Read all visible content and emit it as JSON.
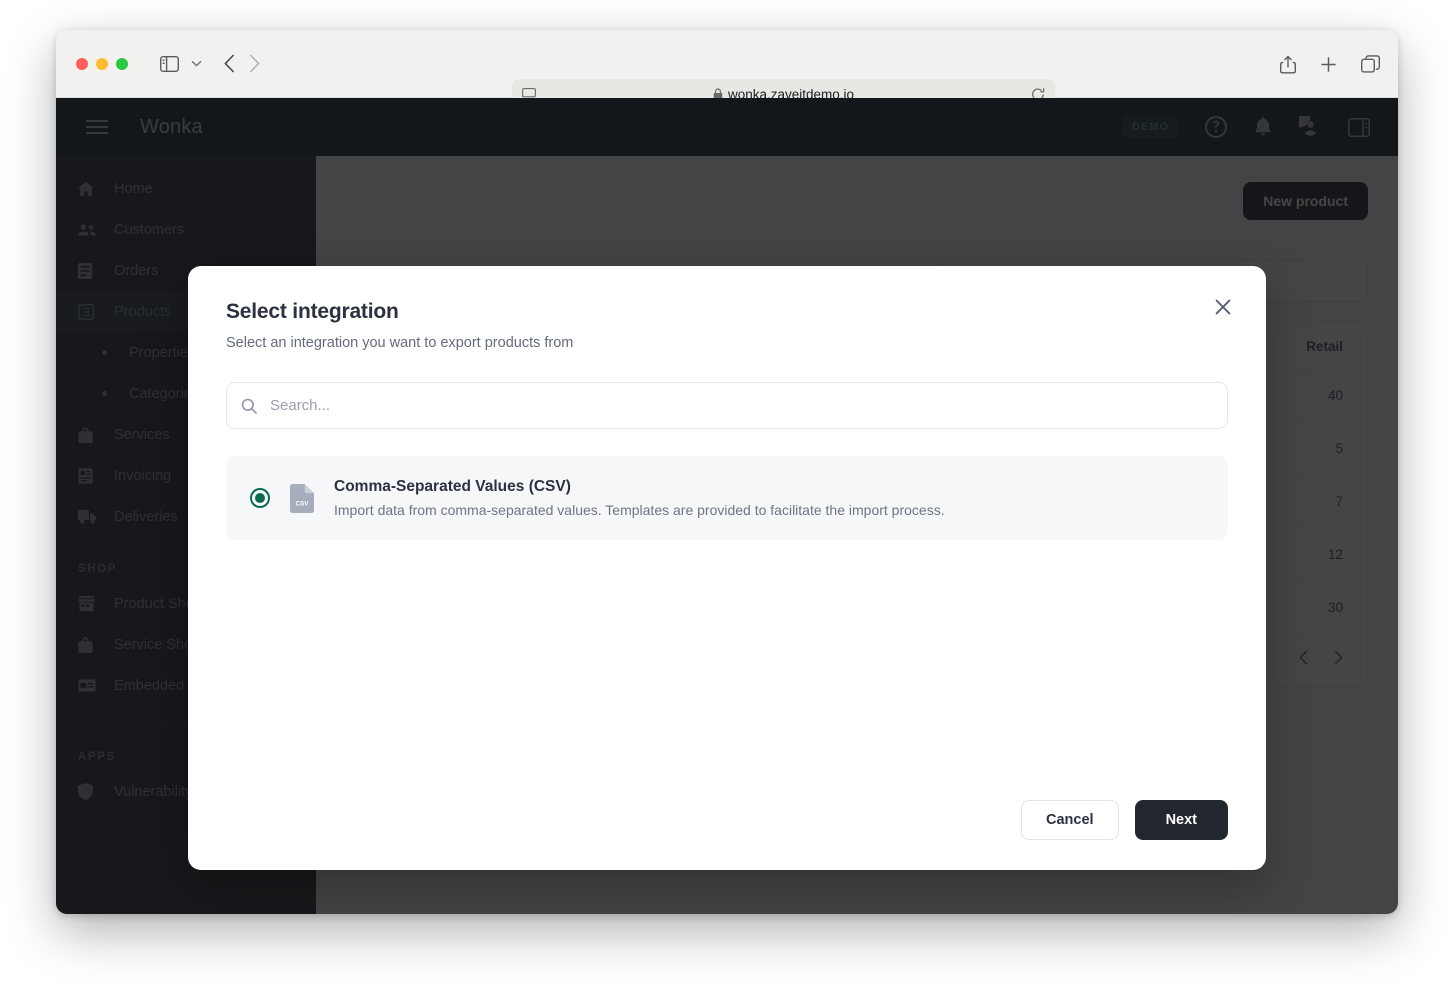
{
  "browser": {
    "url": "wonka.zaveitdemo.io",
    "lock_icon": "lock-icon",
    "reader_icon": "reader-view-icon",
    "reload_icon": "reload-icon",
    "sidebar_icon": "sidebar-toggle-icon",
    "back_icon": "back-arrow-icon",
    "forward_icon": "forward-arrow-icon",
    "share_icon": "share-icon",
    "new_tab_icon": "plus-icon",
    "tabs_icon": "tab-overview-icon"
  },
  "app_header": {
    "brand": "Wonka",
    "badge": "DEMO",
    "menu_icon": "hamburger-icon",
    "help_icon": "help-circle-icon",
    "bell_icon": "bell-icon",
    "account_icon": "account-circle-icon",
    "panel_icon": "right-panel-icon"
  },
  "sidebar": {
    "items": [
      {
        "label": "Home",
        "icon": "home-icon",
        "active": false
      },
      {
        "label": "Customers",
        "icon": "people-icon",
        "active": false
      },
      {
        "label": "Orders",
        "icon": "orders-icon",
        "active": false
      },
      {
        "label": "Products",
        "icon": "products-icon",
        "active": true
      }
    ],
    "sub_items": [
      {
        "label": "Properties"
      },
      {
        "label": "Categories"
      }
    ],
    "items_after": [
      {
        "label": "Services",
        "icon": "bag-icon",
        "active": false
      },
      {
        "label": "Invoicing",
        "icon": "invoice-icon",
        "active": false
      },
      {
        "label": "Deliveries",
        "icon": "truck-icon",
        "active": false
      }
    ],
    "shop_section": "SHOP",
    "shop_items": [
      {
        "label": "Product Shop",
        "icon": "storefront-icon"
      },
      {
        "label": "Service Shop",
        "icon": "bag-icon"
      },
      {
        "label": "Embedded Shop",
        "icon": "embed-icon"
      }
    ],
    "apps_section": "APPS",
    "apps_items": [
      {
        "label": "Vulnerability Scan",
        "icon": "shield-icon",
        "chevron": "chevron-right-icon"
      }
    ]
  },
  "content": {
    "new_product_label": "New product",
    "column_header": "Retail",
    "rows": [
      "40",
      "5",
      "7",
      "12",
      "30"
    ],
    "prev_icon": "chevron-left-icon",
    "next_icon": "chevron-right-icon"
  },
  "modal": {
    "title": "Select integration",
    "subtitle": "Select an integration you want to export products from",
    "close_icon": "close-icon",
    "search": {
      "placeholder": "Search...",
      "value": "",
      "icon": "search-icon"
    },
    "options": [
      {
        "title": "Comma-Separated Values (CSV)",
        "description": "Import data from comma-separated values. Templates are provided to facilitate the import process.",
        "icon": "csv-file-icon",
        "selected": true
      }
    ],
    "cancel_label": "Cancel",
    "next_label": "Next"
  },
  "colors": {
    "accent_green": "#0a6b54",
    "header_dark": "#0c1d1b",
    "sidebar_dark": "#1f2024",
    "button_dark": "#22262f"
  }
}
